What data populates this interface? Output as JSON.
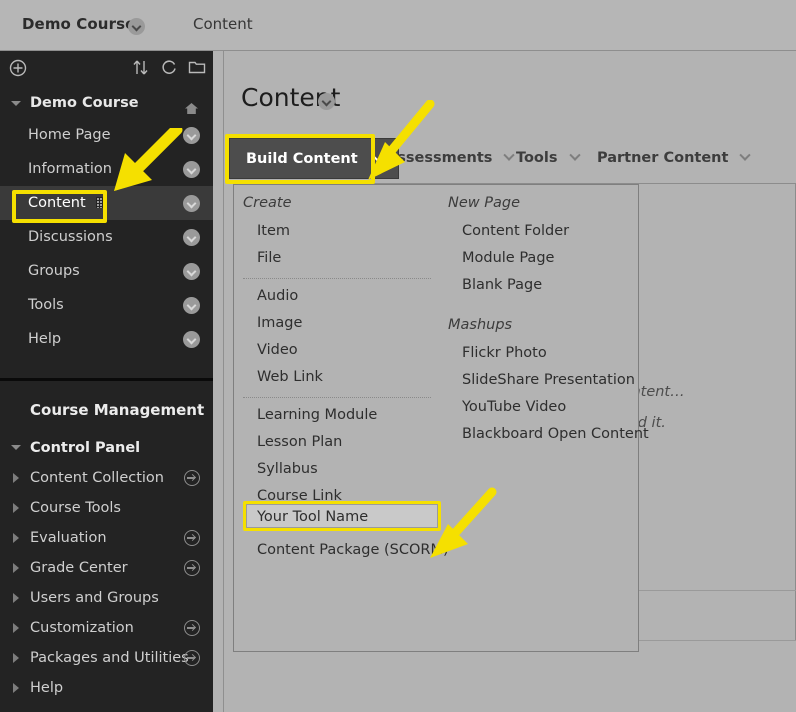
{
  "header": {
    "course_title": "Demo Course",
    "course_chevron_icon": "chevron-down-icon",
    "breadcrumb": "Content"
  },
  "sidebar": {
    "toolbar": {
      "add_icon": "plus-circle-icon",
      "sort_icon": "sort-arrows-icon",
      "refresh_icon": "refresh-icon",
      "folder_icon": "folder-icon"
    },
    "course_menu": {
      "title": "Demo Course",
      "home_icon": "home-icon",
      "items": [
        {
          "label": "Home Page",
          "icon": "",
          "selected": false
        },
        {
          "label": "Information",
          "icon": "grid-icon",
          "selected": false
        },
        {
          "label": "Content",
          "icon": "grid-icon",
          "selected": true
        },
        {
          "label": "Discussions",
          "icon": "",
          "selected": false
        },
        {
          "label": "Groups",
          "icon": "",
          "selected": false
        },
        {
          "label": "Tools",
          "icon": "",
          "selected": false
        },
        {
          "label": "Help",
          "icon": "",
          "selected": false
        }
      ]
    },
    "management": {
      "title": "Course Management",
      "control_panel_label": "Control Panel",
      "items": [
        {
          "label": "Content Collection",
          "has_arrow": true
        },
        {
          "label": "Course Tools",
          "has_arrow": false
        },
        {
          "label": "Evaluation",
          "has_arrow": true
        },
        {
          "label": "Grade Center",
          "has_arrow": true
        },
        {
          "label": "Users and Groups",
          "has_arrow": false
        },
        {
          "label": "Customization",
          "has_arrow": true
        },
        {
          "label": "Packages and Utilities",
          "has_arrow": true
        },
        {
          "label": "Help",
          "has_arrow": false
        }
      ]
    }
  },
  "main": {
    "page_title": "Content",
    "page_title_chevron_icon": "chevron-down-icon",
    "action_bar": {
      "build_content_label": "Build Content",
      "tabs": [
        {
          "label": "Assessments"
        },
        {
          "label": "Tools"
        },
        {
          "label": "Partner Content"
        }
      ]
    },
    "background_text": {
      "line1": "s time to add content…",
      "line2": "functions above to add it."
    }
  },
  "build_menu": {
    "groups": [
      {
        "label": "Create",
        "column": "left",
        "sections": [
          {
            "items": [
              "Item",
              "File"
            ]
          },
          {
            "items": [
              "Audio",
              "Image",
              "Video",
              "Web Link"
            ]
          },
          {
            "items": [
              "Learning Module",
              "Lesson Plan",
              "Syllabus",
              "Course Link",
              "Your Tool Name",
              "Content Package (SCORM)"
            ]
          }
        ]
      },
      {
        "label": "New Page",
        "column": "right",
        "sections": [
          {
            "items": [
              "Content Folder",
              "Module Page",
              "Blank Page"
            ]
          }
        ]
      },
      {
        "label": "Mashups",
        "column": "right",
        "sections": [
          {
            "items": [
              "Flickr Photo",
              "SlideShare Presentation",
              "YouTube Video",
              "Blackboard Open Content"
            ]
          }
        ]
      }
    ],
    "highlighted_item": "Your Tool Name"
  },
  "annotations": {
    "highlight_color": "#f5e000",
    "arrow_color": "#f5e000",
    "boxes": [
      {
        "target": "sidebar-item-content"
      },
      {
        "target": "build-content-button"
      },
      {
        "target": "menu-item-your-tool-name"
      }
    ],
    "arrows": [
      {
        "points_to": "sidebar-item-content"
      },
      {
        "points_to": "build-content-button"
      },
      {
        "points_to": "menu-item-your-tool-name"
      }
    ]
  },
  "colors": {
    "page_bg": "#b3b3b3",
    "sidebar_bg": "#232323",
    "button_bg": "#4d4d4d",
    "accent_yellow": "#f5e000"
  }
}
